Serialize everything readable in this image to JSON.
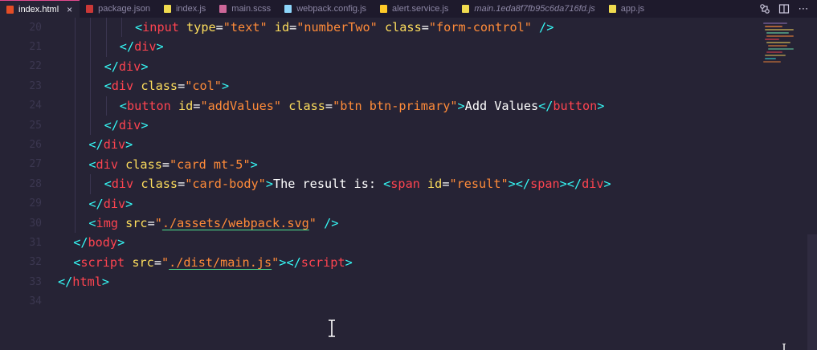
{
  "tabs": [
    {
      "label": "index.html",
      "icon": "html-file-icon",
      "color": "#e44d26",
      "active": true,
      "closable": true
    },
    {
      "label": "package.json",
      "icon": "npm-file-icon",
      "color": "#cb3837",
      "active": false
    },
    {
      "label": "index.js",
      "icon": "js-file-icon",
      "color": "#f0db4f",
      "active": false
    },
    {
      "label": "main.scss",
      "icon": "scss-file-icon",
      "color": "#cd6799",
      "active": false
    },
    {
      "label": "webpack.config.js",
      "icon": "webpack-file-icon",
      "color": "#8ed6fb",
      "active": false
    },
    {
      "label": "alert.service.js",
      "icon": "service-file-icon",
      "color": "#ffca28",
      "active": false
    },
    {
      "label": "main.1eda8f7fb95c6da716fd.js",
      "icon": "js-file-icon",
      "color": "#f0db4f",
      "active": false,
      "preview": true
    },
    {
      "label": "app.js",
      "icon": "js-file-icon",
      "color": "#f0db4f",
      "active": false
    }
  ],
  "tab_close_glyph": "×",
  "actions": [
    {
      "icon": "open-changes-icon"
    },
    {
      "icon": "split-editor-icon"
    },
    {
      "icon": "more-actions-icon",
      "glyph": "⋯"
    }
  ],
  "colors": {
    "background": "#262335",
    "tabbar": "#1e1a2c",
    "tag": "#fe4450",
    "attribute": "#fede5d",
    "string": "#ff8b39",
    "punctuation": "#36f9f6",
    "text": "#ffffff",
    "link_underline": "#4ee38f"
  },
  "editor": {
    "lines": [
      {
        "number": "20",
        "tokens": [
          [
            "br",
            "<"
          ],
          [
            "el",
            "input"
          ],
          [
            "plain",
            " "
          ],
          [
            "an",
            "type"
          ],
          [
            "plain",
            "="
          ],
          [
            "av",
            "\"text\""
          ],
          [
            "plain",
            " "
          ],
          [
            "an",
            "id"
          ],
          [
            "plain",
            "="
          ],
          [
            "av",
            "\"numberTwo\""
          ],
          [
            "plain",
            " "
          ],
          [
            "an",
            "class"
          ],
          [
            "plain",
            "="
          ],
          [
            "av",
            "\"form-control\""
          ],
          [
            "plain",
            " "
          ],
          [
            "br",
            "/>"
          ]
        ]
      },
      {
        "number": "21",
        "tokens": [
          [
            "br",
            "</"
          ],
          [
            "el",
            "div"
          ],
          [
            "br",
            ">"
          ]
        ]
      },
      {
        "number": "22",
        "tokens": [
          [
            "br",
            "</"
          ],
          [
            "el",
            "div"
          ],
          [
            "br",
            ">"
          ]
        ]
      },
      {
        "number": "23",
        "tokens": [
          [
            "br",
            "<"
          ],
          [
            "el",
            "div"
          ],
          [
            "plain",
            " "
          ],
          [
            "an",
            "class"
          ],
          [
            "plain",
            "="
          ],
          [
            "av",
            "\"col\""
          ],
          [
            "br",
            ">"
          ]
        ]
      },
      {
        "number": "24",
        "tokens": [
          [
            "br",
            "<"
          ],
          [
            "el",
            "button"
          ],
          [
            "plain",
            " "
          ],
          [
            "an",
            "id"
          ],
          [
            "plain",
            "="
          ],
          [
            "av",
            "\"addValues\""
          ],
          [
            "plain",
            " "
          ],
          [
            "an",
            "class"
          ],
          [
            "plain",
            "="
          ],
          [
            "av",
            "\"btn btn-primary\""
          ],
          [
            "br",
            ">"
          ],
          [
            "plain",
            "Add Values"
          ],
          [
            "br",
            "</"
          ],
          [
            "el",
            "button"
          ],
          [
            "br",
            ">"
          ]
        ]
      },
      {
        "number": "25",
        "tokens": [
          [
            "br",
            "</"
          ],
          [
            "el",
            "div"
          ],
          [
            "br",
            ">"
          ]
        ]
      },
      {
        "number": "26",
        "tokens": [
          [
            "br",
            "</"
          ],
          [
            "el",
            "div"
          ],
          [
            "br",
            ">"
          ]
        ]
      },
      {
        "number": "27",
        "tokens": [
          [
            "br",
            "<"
          ],
          [
            "el",
            "div"
          ],
          [
            "plain",
            " "
          ],
          [
            "an",
            "class"
          ],
          [
            "plain",
            "="
          ],
          [
            "av",
            "\"card mt-5\""
          ],
          [
            "br",
            ">"
          ]
        ]
      },
      {
        "number": "28",
        "tokens": [
          [
            "br",
            "<"
          ],
          [
            "el",
            "div"
          ],
          [
            "plain",
            " "
          ],
          [
            "an",
            "class"
          ],
          [
            "plain",
            "="
          ],
          [
            "av",
            "\"card-body\""
          ],
          [
            "br",
            ">"
          ],
          [
            "plain",
            "The result is: "
          ],
          [
            "br",
            "<"
          ],
          [
            "el",
            "span"
          ],
          [
            "plain",
            " "
          ],
          [
            "an",
            "id"
          ],
          [
            "plain",
            "="
          ],
          [
            "av",
            "\"result\""
          ],
          [
            "br",
            "></"
          ],
          [
            "el",
            "span"
          ],
          [
            "br",
            "></"
          ],
          [
            "el",
            "div"
          ],
          [
            "br",
            ">"
          ]
        ]
      },
      {
        "number": "29",
        "tokens": [
          [
            "br",
            "</"
          ],
          [
            "el",
            "div"
          ],
          [
            "br",
            ">"
          ]
        ]
      },
      {
        "number": "30",
        "tokens": [
          [
            "br",
            "<"
          ],
          [
            "el",
            "img"
          ],
          [
            "plain",
            " "
          ],
          [
            "an",
            "src"
          ],
          [
            "plain",
            "="
          ],
          [
            "av",
            "\""
          ],
          [
            "avl",
            "./assets/webpack.svg"
          ],
          [
            "av",
            "\""
          ],
          [
            "plain",
            " "
          ],
          [
            "br",
            "/>"
          ]
        ]
      },
      {
        "number": "31",
        "tokens": [
          [
            "br",
            "</"
          ],
          [
            "el",
            "body"
          ],
          [
            "br",
            ">"
          ]
        ]
      },
      {
        "number": "32",
        "tokens": [
          [
            "br",
            "<"
          ],
          [
            "el",
            "script"
          ],
          [
            "plain",
            " "
          ],
          [
            "an",
            "src"
          ],
          [
            "plain",
            "="
          ],
          [
            "av",
            "\""
          ],
          [
            "avl",
            "./dist/main.js"
          ],
          [
            "av",
            "\""
          ],
          [
            "br",
            "></"
          ],
          [
            "el",
            "script"
          ],
          [
            "br",
            ">"
          ]
        ]
      },
      {
        "number": "33",
        "tokens": [
          [
            "br",
            "</"
          ],
          [
            "el",
            "html"
          ],
          [
            "br",
            ">"
          ]
        ]
      },
      {
        "number": "34",
        "tokens": []
      }
    ]
  }
}
